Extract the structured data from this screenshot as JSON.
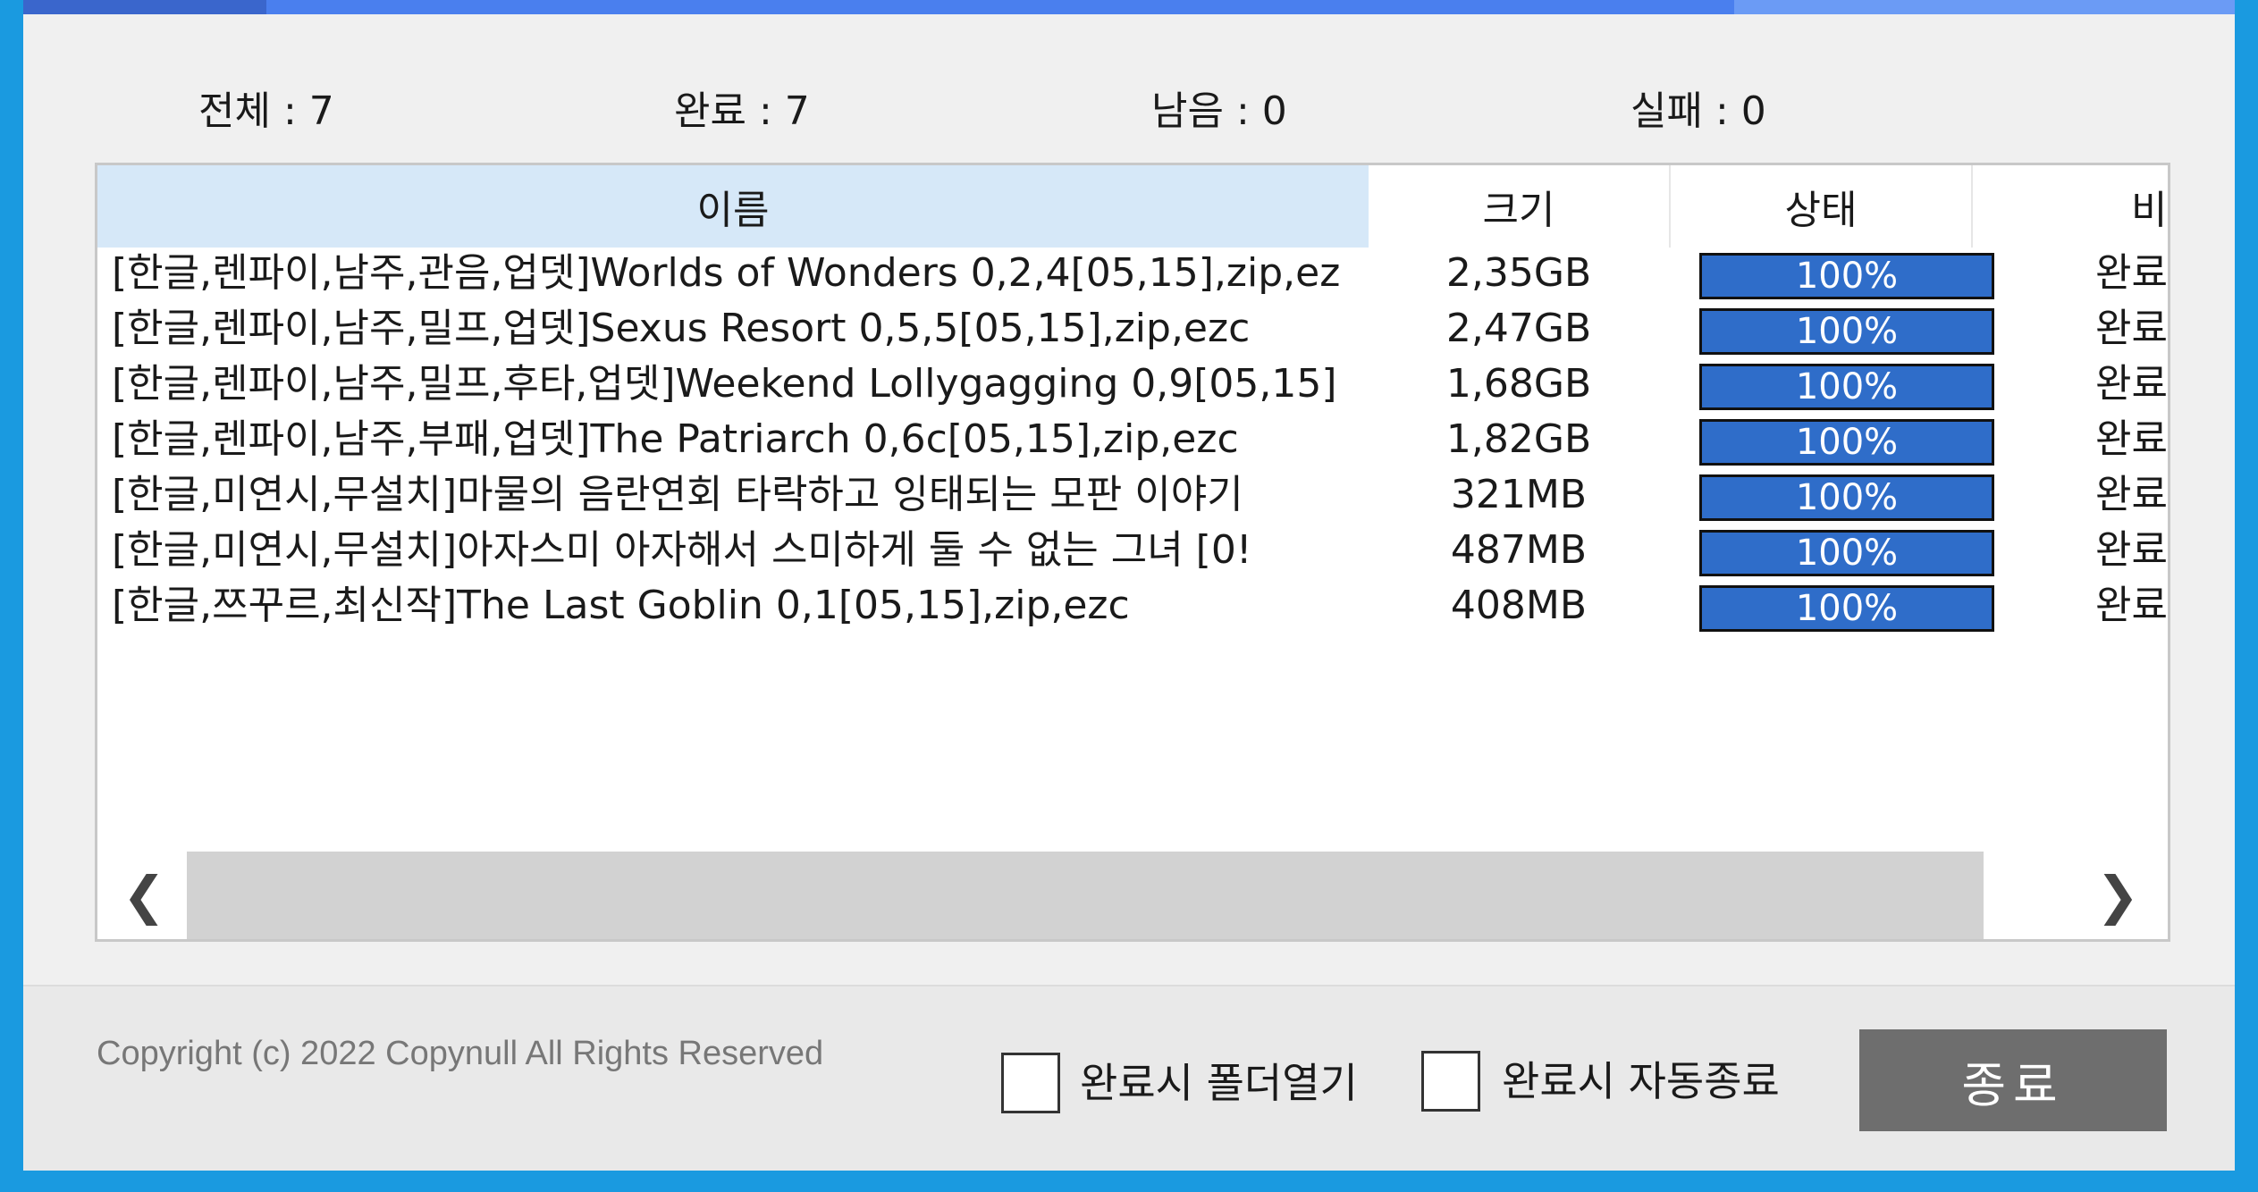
{
  "stats": {
    "total": "전체 : 7",
    "done": "완료 : 7",
    "remaining": "남음 : 0",
    "failed": "실패 : 0"
  },
  "table": {
    "columns": {
      "name": "이름",
      "size": "크기",
      "state": "상태",
      "note": "비고"
    },
    "rows": [
      {
        "name": "[한글,렌파이,남주,관음,업뎃]Worlds of Wonders 0,2,4[05,15],zip,ez",
        "size": "2,35GB",
        "progress": "100%",
        "note": "완료"
      },
      {
        "name": "[한글,렌파이,남주,밀프,업뎃]Sexus Resort 0,5,5[05,15],zip,ezc",
        "size": "2,47GB",
        "progress": "100%",
        "note": "완료"
      },
      {
        "name": "[한글,렌파이,남주,밀프,후타,업뎃]Weekend Lollygagging 0,9[05,15]",
        "size": "1,68GB",
        "progress": "100%",
        "note": "완료"
      },
      {
        "name": "[한글,렌파이,남주,부패,업뎃]The Patriarch 0,6c[05,15],zip,ezc",
        "size": "1,82GB",
        "progress": "100%",
        "note": "완료"
      },
      {
        "name": "[한글,미연시,무설치]마물의 음란연회 타락하고 잉태되는 모판 이야기",
        "size": "321MB",
        "progress": "100%",
        "note": "완료"
      },
      {
        "name": "[한글,미연시,무설치]아자스미 아자해서 스미하게 둘 수 없는 그녀 [0!",
        "size": "487MB",
        "progress": "100%",
        "note": "완료"
      },
      {
        "name": "[한글,쯔꾸르,최신작]The Last Goblin 0,1[05,15],zip,ezc",
        "size": "408MB",
        "progress": "100%",
        "note": "완료"
      }
    ]
  },
  "scrollbar": {
    "left_icon": "chevron-left-icon",
    "right_icon": "chevron-right-icon"
  },
  "footer": {
    "copyright": "Copyright (c) 2022 Copynull All Rights Reserved",
    "open_folder_label": "완료시 폴더열기",
    "auto_exit_label": "완료시 자동종료",
    "exit_label": "종료"
  },
  "colors": {
    "progress_fill": "#2f6dc9",
    "title_bar": "#4a7fee",
    "background": "#1a9ae0",
    "button": "#6e6e6e"
  }
}
